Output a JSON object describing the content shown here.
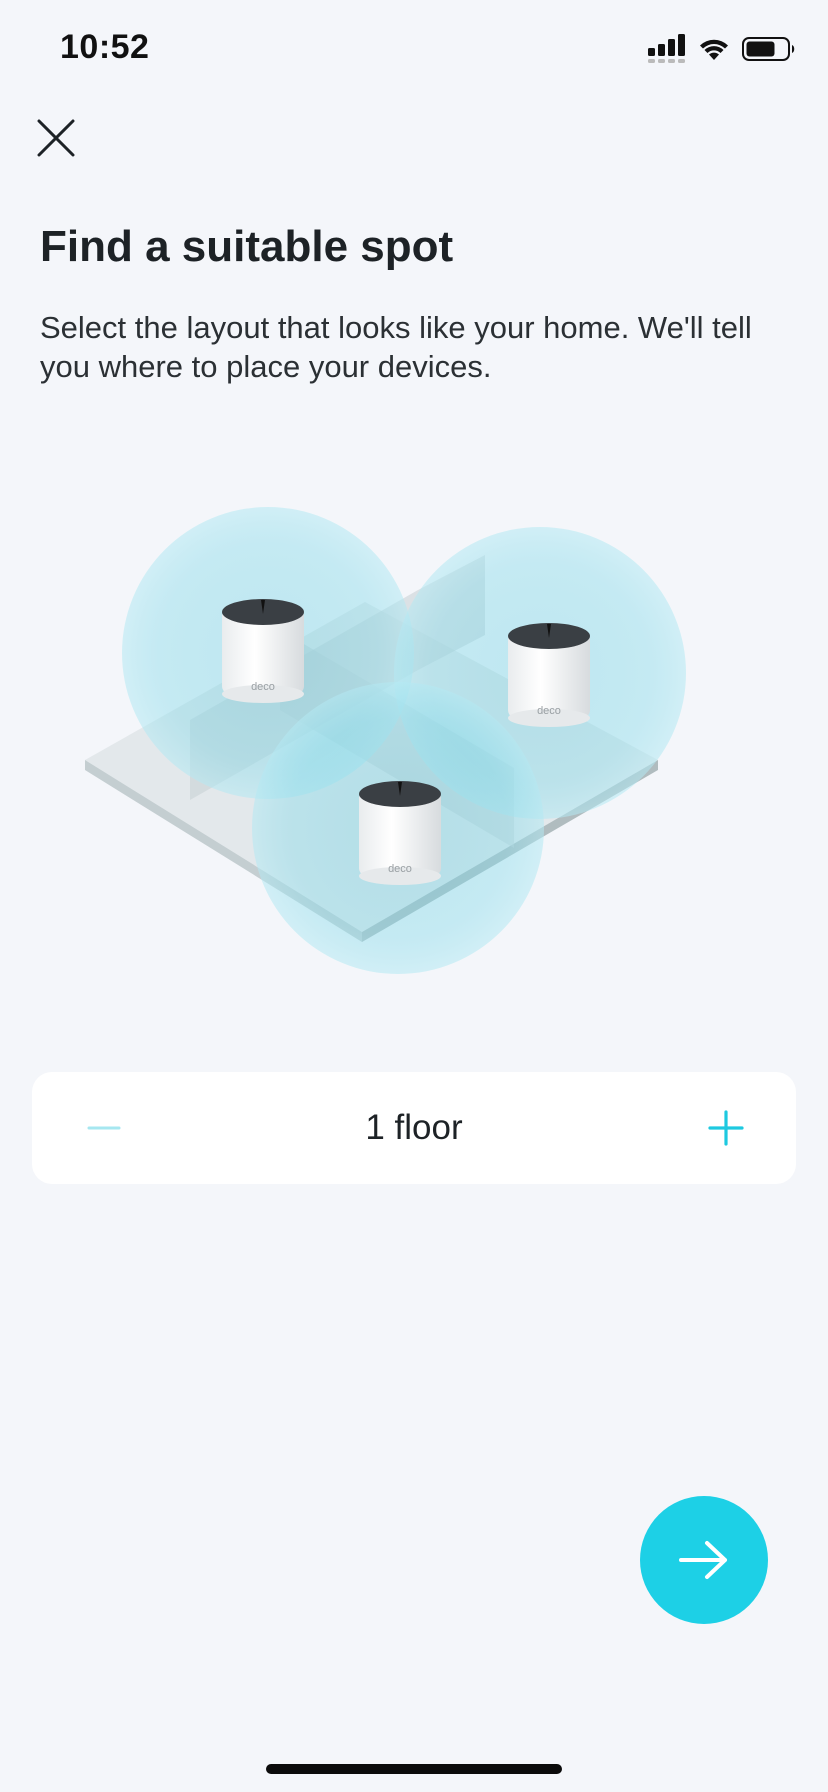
{
  "status_bar": {
    "time": "10:52"
  },
  "header": {
    "close_icon": "close-icon"
  },
  "content": {
    "title": "Find a suitable spot",
    "description": "Select the layout that looks like your home. We'll tell you where to place your devices."
  },
  "illustration": {
    "device_label": "deco",
    "device_count": 3
  },
  "floor_stepper": {
    "value": "1 floor",
    "minus_icon": "minus-icon",
    "plus_icon": "plus-icon"
  },
  "next_button": {
    "icon": "arrow-right-icon"
  },
  "colors": {
    "accent": "#1dd0e6",
    "accent_disabled": "#a6e7f0",
    "background": "#f4f6fa",
    "card": "#ffffff",
    "text": "#1d2226"
  }
}
